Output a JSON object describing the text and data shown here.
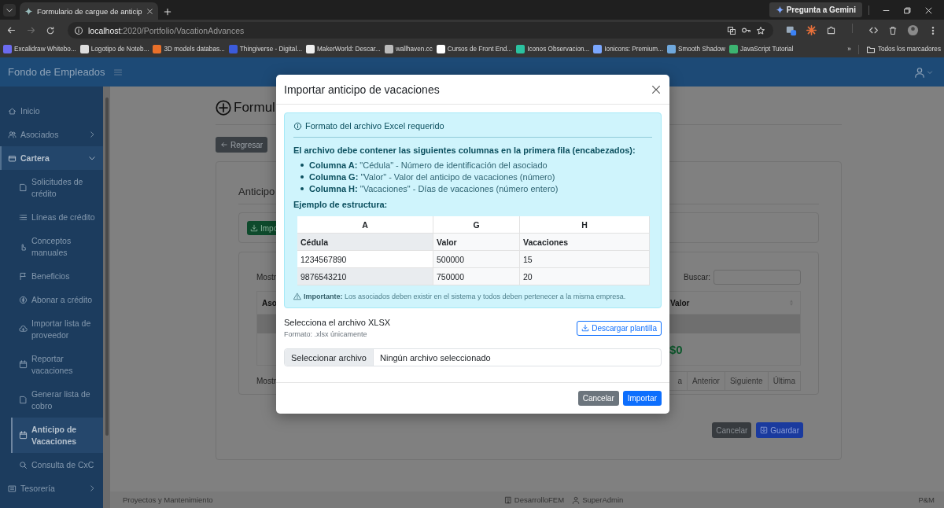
{
  "browser": {
    "tab": {
      "title": "Formulario de cargue de anticip"
    },
    "gemini_button": "Pregunta a Gemini",
    "address": {
      "host": "localhost",
      "path": ":2020/Portfolio/VacationAdvances"
    },
    "bookmarks": [
      "Excalidraw Whitebo...",
      "Logotipo de Noteb...",
      "3D models databas...",
      "Thingiverse - Digital...",
      "MakerWorld: Descar...",
      "wallhaven.cc",
      "Cursos de Front End...",
      "Iconos Observacion...",
      "Ionicons: Premium...",
      "Smooth Shadow",
      "JavaScript Tutorial"
    ],
    "more_bookmarks": "»",
    "all_bookmarks": "Todos los marcadores"
  },
  "app": {
    "title": "Fondo de Empleados"
  },
  "sidebar": {
    "items": [
      {
        "label": "Inicio",
        "kind": "link",
        "selected": false
      },
      {
        "label": "Asociados",
        "kind": "group",
        "selected": false,
        "expanded": false
      },
      {
        "label": "Cartera",
        "kind": "group",
        "selected": true,
        "expanded": true,
        "children": [
          {
            "label": "Solicitudes de crédito",
            "selected": false
          },
          {
            "label": "Líneas de crédito",
            "selected": false
          },
          {
            "label": "Conceptos manuales",
            "selected": false
          },
          {
            "label": "Beneficios",
            "selected": false
          },
          {
            "label": "Abonar a crédito",
            "selected": false
          },
          {
            "label": "Importar lista de proveedor",
            "selected": false
          },
          {
            "label": "Reportar vacaciones",
            "selected": false
          },
          {
            "label": "Generar lista de cobro",
            "selected": false
          },
          {
            "label": "Anticipo de Vacaciones",
            "selected": true
          },
          {
            "label": "Consulta de CxC",
            "selected": false
          }
        ]
      },
      {
        "label": "Tesorería",
        "kind": "group",
        "selected": false,
        "expanded": false
      }
    ]
  },
  "page": {
    "title": "Formul",
    "back_button": "Regresar",
    "card_title": "Anticipo",
    "import_button": "Impo",
    "table": {
      "length_label": "Mostr",
      "search_label": "Buscar:",
      "columns": [
        "Aso",
        "Valor"
      ],
      "total": "$0",
      "info": "Mostr",
      "pagination": [
        "a",
        "Anterior",
        "Siguiente",
        "Última"
      ]
    },
    "buttons": [
      {
        "label": "Cancelar",
        "kind": "secondary"
      },
      {
        "label": "Guardar",
        "kind": "primary"
      }
    ]
  },
  "modal": {
    "title": "Importar anticipo de vacaciones",
    "alert": {
      "title": "Formato del archivo Excel requerido",
      "intro": "El archivo debe contener las siguientes columnas en la primera fila (encabezados):",
      "columns": [
        "**Columna A:** \"Cédula\" - Número de identificación del asociado",
        "**Columna G:** \"Valor\" - Valor del anticipo de vacaciones (número)",
        "**Columna H:** \"Vacaciones\" - Días de vacaciones (número entero)"
      ],
      "example_label": "Ejemplo de estructura:",
      "example_table": {
        "columns": [
          "A",
          "G",
          "H"
        ],
        "rows": [
          {
            "kind": "header",
            "cells": [
              "Cédula",
              "Valor",
              "Vacaciones"
            ]
          },
          {
            "kind": "data",
            "cells": [
              "1234567890",
              "500000",
              "15"
            ]
          },
          {
            "kind": "data",
            "cells": [
              "9876543210",
              "750000",
              "20"
            ]
          }
        ]
      },
      "note": "**Importante:** Los asociados deben existir en el sistema y todos deben pertenecer a la misma empresa."
    },
    "file_label": "Selecciona el archivo XLSX",
    "file_hint": "Formato: .xlsx únicamente",
    "template_button": "Descargar plantilla",
    "file_input": {
      "button": "Seleccionar archivo",
      "value": "Ningún archivo seleccionado"
    },
    "buttons": [
      {
        "label": "Cancelar",
        "kind": "secondary"
      },
      {
        "label": "Importar",
        "kind": "primary"
      }
    ]
  },
  "footer": {
    "left": "Proyectos y Mantenimiento",
    "items": [
      "DesarrolloFEM",
      "SuperAdmin"
    ],
    "right": "P&M"
  }
}
